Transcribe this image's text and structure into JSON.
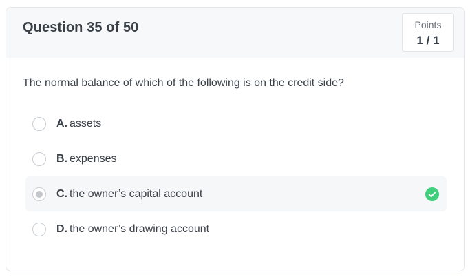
{
  "header": {
    "question_title": "Question 35 of 50",
    "points_label": "Points",
    "points_value": "1 / 1"
  },
  "question_text": "The normal balance of which of the following is on the credit side?",
  "options": [
    {
      "letter": "A.",
      "text": "assets",
      "selected": false,
      "correct": false
    },
    {
      "letter": "B.",
      "text": "expenses",
      "selected": false,
      "correct": false
    },
    {
      "letter": "C.",
      "text": "the owner’s capital account",
      "selected": true,
      "correct": true
    },
    {
      "letter": "D.",
      "text": "the owner’s drawing account",
      "selected": false,
      "correct": false
    }
  ],
  "colors": {
    "correct_check": "#3ecf7d",
    "selected_row_bg": "#f6f7f8",
    "header_bg": "#f7f8f9"
  },
  "icons": {
    "correct_indicator": "check-circle-icon"
  }
}
